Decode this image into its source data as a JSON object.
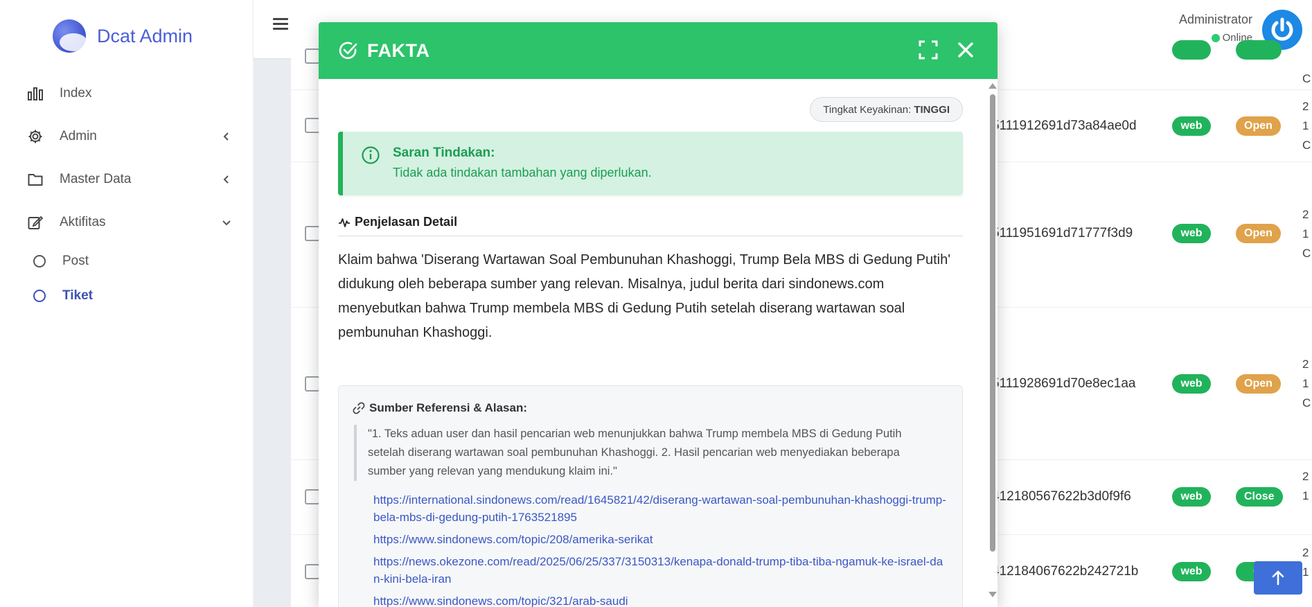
{
  "app": {
    "brand": "Dcat Admin"
  },
  "sidebar": {
    "items": [
      {
        "label": "Index",
        "icon": "bar-chart-icon"
      },
      {
        "label": "Admin",
        "icon": "gear-icon"
      },
      {
        "label": "Master Data",
        "icon": "folder-icon"
      },
      {
        "label": "Aktifitas",
        "icon": "edit-icon"
      }
    ],
    "subitems": [
      {
        "label": "Post",
        "active": false
      },
      {
        "label": "Tiket",
        "active": true
      }
    ]
  },
  "header": {
    "user": "Administrator",
    "status": "Online"
  },
  "table": {
    "rows": [
      {
        "hash": "",
        "source": "",
        "status": ""
      },
      {
        "hash": "5111912691d73a84ae0d",
        "source": "web",
        "status": "Open"
      },
      {
        "hash": "5111951691d71777f3d9",
        "source": "web",
        "status": "Open"
      },
      {
        "hash": "5111928691d70e8ec1aa",
        "source": "web",
        "status": "Open"
      },
      {
        "hash": "412180567622b3d0f9f6",
        "source": "web",
        "status": "Close"
      },
      {
        "hash": "412184067622b242721b",
        "source": "web",
        "status": "Cl"
      }
    ],
    "edge": [
      "C",
      "2",
      "1",
      "C",
      "2",
      "1",
      "C",
      "2",
      "1",
      "C",
      "2",
      "1",
      "2",
      "1"
    ]
  },
  "modal": {
    "title": "FAKTA",
    "confidence_label": "Tingkat Keyakinan:",
    "confidence_value": "TINGGI",
    "alert_title": "Saran Tindakan:",
    "alert_text": "Tidak ada tindakan tambahan yang diperlukan.",
    "detail_title": "Penjelasan Detail",
    "detail_text": "Klaim bahwa 'Diserang Wartawan Soal Pembunuhan Khashoggi, Trump Bela MBS di Gedung Putih' didukung oleh beberapa sumber yang relevan. Misalnya, judul berita dari sindonews.com menyebutkan bahwa Trump membela MBS di Gedung Putih setelah diserang wartawan soal pembunuhan Khashoggi.",
    "ref_title": "Sumber Referensi & Alasan:",
    "ref_quote": "\"1. Teks aduan user dan hasil pencarian web menunjukkan bahwa Trump membela MBS di Gedung Putih setelah diserang wartawan soal pembunuhan Khashoggi. 2. Hasil pencarian web menyediakan beberapa sumber yang relevan yang mendukung klaim ini.\"",
    "links": [
      "https://international.sindonews.com/read/1645821/42/diserang-wartawan-soal-pembunuhan-khashoggi-trump-bela-mbs-di-gedung-putih-1763521895",
      "https://www.sindonews.com/topic/208/amerika-serikat",
      "https://news.okezone.com/read/2025/06/25/337/3150313/kenapa-donald-trump-tiba-tiba-ngamuk-ke-israel-dan-kini-bela-iran",
      "https://www.sindonews.com/topic/321/arab-saudi"
    ]
  },
  "colors": {
    "accent": "#2dc36a",
    "brand": "#4a5fd6",
    "open": "#e0a24a",
    "web": "#21b35b"
  }
}
